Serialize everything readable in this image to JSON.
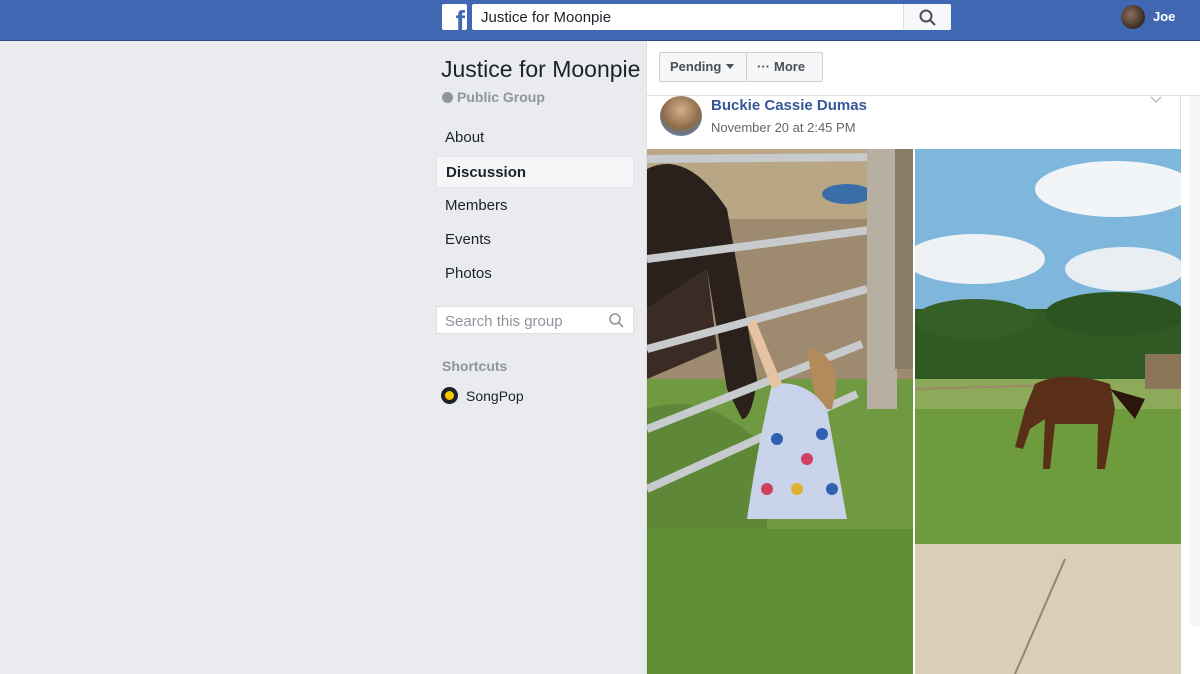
{
  "topbar": {
    "search_value": "Justice for Moonpie",
    "user_name": "Joe"
  },
  "group": {
    "title": "Justice for Moonpie",
    "privacy": "Public Group"
  },
  "nav": {
    "items": [
      {
        "label": "About"
      },
      {
        "label": "Discussion",
        "active": true
      },
      {
        "label": "Members"
      },
      {
        "label": "Events"
      },
      {
        "label": "Photos"
      }
    ]
  },
  "group_search": {
    "placeholder": "Search this group"
  },
  "shortcuts": {
    "title": "Shortcuts",
    "items": [
      {
        "label": "SongPop",
        "icon": "songpop-icon"
      }
    ]
  },
  "actions": {
    "pending_label": "Pending",
    "more_label": "More"
  },
  "post": {
    "author": "Buckie Cassie Dumas",
    "time": "November 20 at 2:45 PM"
  },
  "colors": {
    "brand": "#4267b2",
    "link": "#365899",
    "background": "#e9ebee"
  }
}
